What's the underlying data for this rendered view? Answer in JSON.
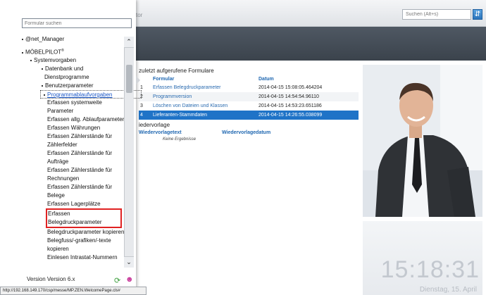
{
  "header": {
    "faint_text": "tor",
    "global_search_placeholder": "Suchen (Alt+s)"
  },
  "recent_forms": {
    "title": "zuletzt aufgerufene Formulare",
    "columns": [
      "",
      "Formular",
      "Datum"
    ],
    "rows": [
      {
        "n": "1",
        "form": "Erfassen Belegdruckparameter",
        "date": "2014-04-15 15:08:05.464204"
      },
      {
        "n": "2",
        "form": "Programmversion",
        "date": "2014-04-15 14:54:54.96110"
      },
      {
        "n": "3",
        "form": "Löschen von Dateien und Klassen",
        "date": "2014-04-15 14:53:23.651186"
      },
      {
        "n": "4",
        "form": "Lieferanten-Stammdaten",
        "date": "2014-04-15 14:26:55.038099"
      }
    ]
  },
  "wiedervorlage": {
    "title": "iedervorlage",
    "col_text": "Wiedervorlagetext",
    "col_date": "Wiedervorlagedatum",
    "empty": "Keine Ergebnisse"
  },
  "clock": {
    "time": "15:18:31",
    "date": "Dienstag, 15. April"
  },
  "menu": {
    "search_placeholder": "Formular suchen",
    "root1": "@net_Manager",
    "root2": "MÖBELPILOT",
    "root2_sup": "®",
    "systemvorgaben": "Systemvorgaben",
    "datenbank1": "Datenbank und",
    "datenbank2": "Dienstprogramme",
    "benutzer": "Benutzerparameter",
    "programmablauf": "Programmablaufvorgaben",
    "items": [
      "Erfassen systemweite",
      "Parameter",
      "Erfassen allg. Ablaufparameter",
      "Erfassen Währungen",
      "Erfassen Zählerstände für",
      "Zählerfelder",
      "Erfassen Zählerstände für",
      "Aufträge",
      "Erfassen Zählerstände für",
      "Rechnungen",
      "Erfassen Zählerstände für",
      "Belege",
      "Erfassen Lagerplätze"
    ],
    "selected1": "Erfassen",
    "selected2": "Belegdruckparameter",
    "items_after": [
      "Belegdruckparameter kopieren",
      "Belegfuss/-grafiken/-texte",
      "kopieren",
      "Einlesen Intrastat-Nummern"
    ],
    "version": "Version Version 6.x"
  },
  "statusbar": "http://192.168.149.170/csp/messe/MP.ZEN.WelcomePage.cls#",
  "icons": {
    "search_go": "search-go-icon",
    "refresh": "refresh-icon",
    "user": "user-icon"
  }
}
